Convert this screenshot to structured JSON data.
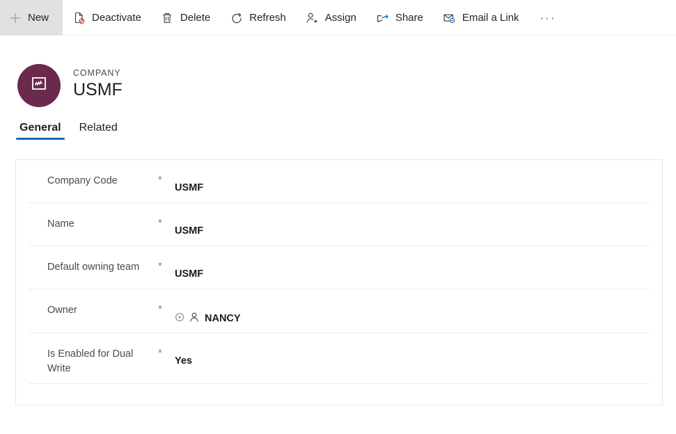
{
  "commandbar": {
    "buttons": [
      {
        "label": "New",
        "icon": "plus-icon",
        "state": "active"
      },
      {
        "label": "Deactivate",
        "icon": "deactivate-icon",
        "state": "normal"
      },
      {
        "label": "Delete",
        "icon": "trash-icon",
        "state": "normal"
      },
      {
        "label": "Refresh",
        "icon": "refresh-icon",
        "state": "normal"
      },
      {
        "label": "Assign",
        "icon": "assign-user-icon",
        "state": "normal"
      },
      {
        "label": "Share",
        "icon": "share-icon",
        "state": "normal"
      },
      {
        "label": "Email a Link",
        "icon": "email-link-icon",
        "state": "normal"
      }
    ],
    "overflow_label": "···"
  },
  "record_header": {
    "entity_type": "COMPANY",
    "record_name": "USMF",
    "avatar_icon": "company-icon",
    "avatar_color": "#6b2a4c"
  },
  "tabs": [
    {
      "label": "General",
      "active": true
    },
    {
      "label": "Related",
      "active": false
    }
  ],
  "form": {
    "required_marker": "*",
    "fields": [
      {
        "label": "Company Code",
        "value": "USMF",
        "required": true
      },
      {
        "label": "Name",
        "value": "USMF",
        "required": true
      },
      {
        "label": "Default owning team",
        "value": "USMF",
        "required": true
      },
      {
        "label": "Owner",
        "value": "NANCY",
        "required": true,
        "has_owner_icons": true
      },
      {
        "label": "Is Enabled for Dual Write",
        "value": "Yes",
        "required": true
      }
    ]
  },
  "colors": {
    "accent_blue": "#0f6cbd",
    "new_green": "#7fba7f",
    "required_red": "#bf6a72",
    "avatar_maroon": "#6b2a4c"
  }
}
